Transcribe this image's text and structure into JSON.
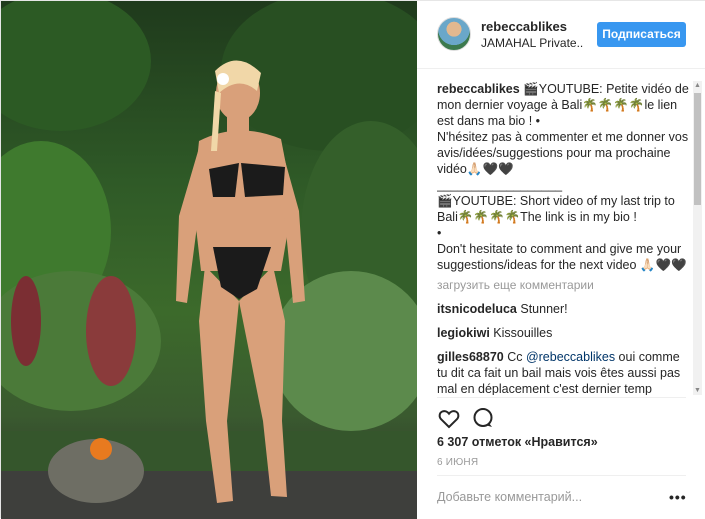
{
  "header": {
    "username": "rebeccablikes",
    "location": "JAMAHAL Private..",
    "follow_label": "Подписаться"
  },
  "caption": {
    "username": "rebeccablikes",
    "lines": [
      "🎬YOUTUBE: Petite vidéo de mon dernier voyage à Bali🌴🌴🌴🌴le lien est dans ma bio ! •",
      "N'hésitez pas à commenter et me donner vos avis/idées/suggestions pour ma prochaine vidéo🙏🏻🖤🖤",
      "__________________",
      "🎬YOUTUBE: Short video of my last trip to Bali🌴🌴🌴🌴The link is in my bio !",
      "•",
      "Don't hesitate to comment and give me your suggestions/ideas for the next video 🙏🏻🖤🖤"
    ]
  },
  "load_more_label": "загрузить еще комментарии",
  "comments": [
    {
      "username": "itsnicodeluca",
      "text": "Stunner!"
    },
    {
      "username": "legiokiwi",
      "text": "Kissouilles"
    },
    {
      "username": "gilles68870",
      "text_before": "Cc ",
      "mention": "@rebeccablikes",
      "text_after": " oui comme tu dit ca fait un bail mais vois êtes aussi pas mal en déplacement c'est dernier temp"
    }
  ],
  "likes_text": "6 307 отметок «Нравится»",
  "date_text": "6 июня",
  "add_comment_placeholder": "Добавьте комментарий...",
  "more_label": "•••",
  "icons": {
    "like": "heart-icon",
    "comment": "comment-bubble-icon",
    "more": "more-options-icon"
  },
  "colors": {
    "follow_button": "#3897f0",
    "mention": "#003569",
    "muted": "#999999"
  }
}
